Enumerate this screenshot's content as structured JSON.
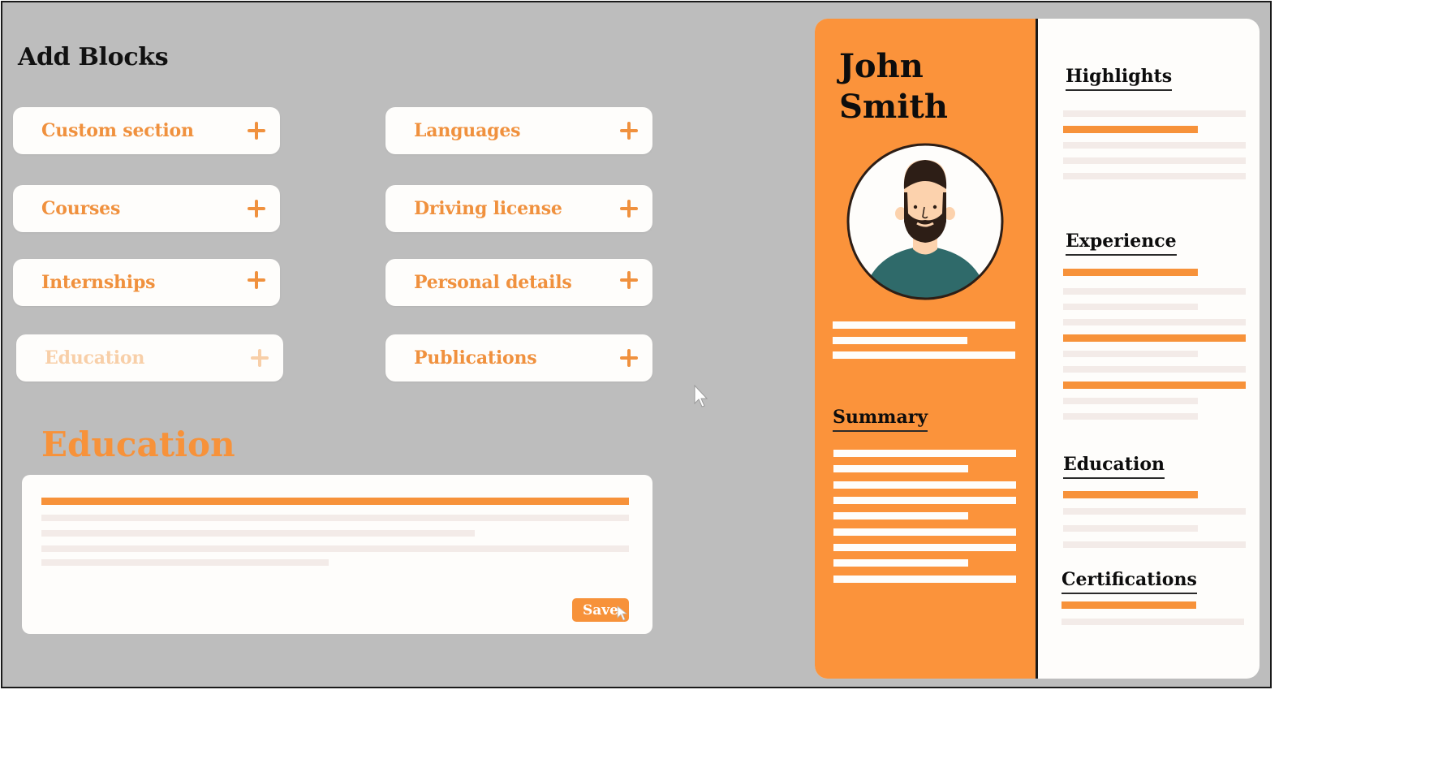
{
  "panel": {
    "title": "Add Blocks",
    "blocks": [
      {
        "label": "Custom section",
        "state": "enabled"
      },
      {
        "label": "Languages",
        "state": "enabled"
      },
      {
        "label": "Courses",
        "state": "enabled"
      },
      {
        "label": "Driving license",
        "state": "enabled"
      },
      {
        "label": "Internships",
        "state": "enabled"
      },
      {
        "label": "Personal details",
        "state": "enabled"
      },
      {
        "label": "Education",
        "state": "disabled"
      },
      {
        "label": "Publications",
        "state": "enabled"
      }
    ],
    "plus_icon": "plus-icon"
  },
  "editor": {
    "title": "Education",
    "save_label": "Save"
  },
  "resume": {
    "first_name": "John",
    "last_name": "Smith",
    "left_sections": {
      "summary": "Summary"
    },
    "right_sections": {
      "highlights": "Highlights",
      "experience": "Experience",
      "education": "Education",
      "certifications": "Certifications"
    }
  },
  "colors": {
    "accent": "#f7923a",
    "background": "#bdbdbd",
    "card": "#fefdfb",
    "placeholder_line": "#f3ebe8",
    "text_dark": "#0d0d0d",
    "avatar_shirt": "#2f6a6a"
  }
}
